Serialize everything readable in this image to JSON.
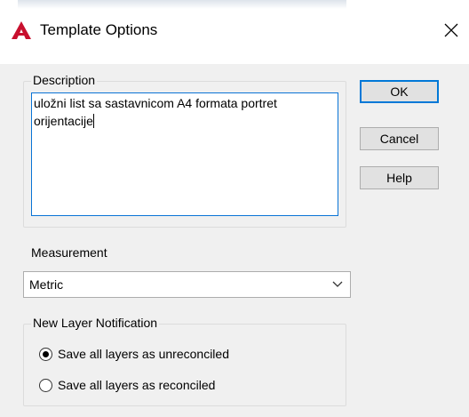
{
  "window": {
    "title": "Template Options",
    "app_icon": "autocad-logo-icon",
    "close_icon": "close-icon",
    "accent_color": "#c8102e"
  },
  "description": {
    "label": "Description",
    "text": "uložni list sa sastavnicom A4 formata portret\norijentacije"
  },
  "buttons": {
    "ok": "OK",
    "cancel": "Cancel",
    "help": "Help"
  },
  "measurement": {
    "label": "Measurement",
    "selected": "Metric",
    "dropdown_icon": "chevron-down-icon"
  },
  "layer_notification": {
    "label": "New Layer Notification",
    "options": [
      {
        "label": "Save all layers as unreconciled",
        "selected": true
      },
      {
        "label": "Save all layers as reconciled",
        "selected": false
      }
    ]
  }
}
